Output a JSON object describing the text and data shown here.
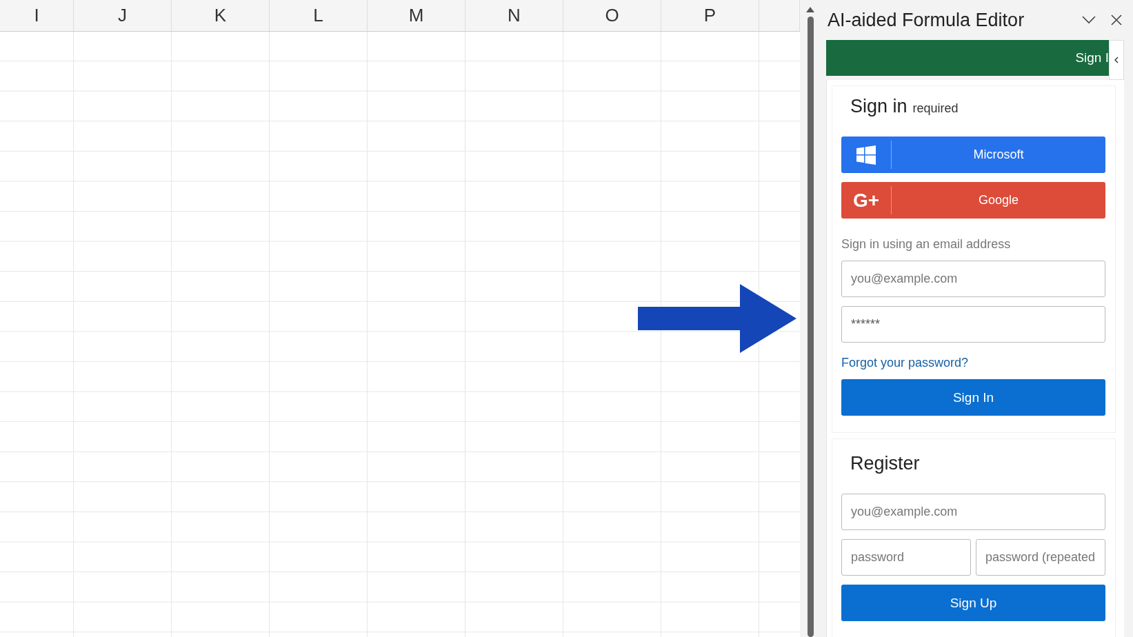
{
  "spreadsheet": {
    "columns": [
      "I",
      "J",
      "K",
      "L",
      "M",
      "N",
      "O",
      "P"
    ]
  },
  "pane": {
    "title": "AI-aided Formula Editor",
    "banner": {
      "text": "Sign I"
    },
    "signin": {
      "heading": "Sign in",
      "note": "required",
      "providers": [
        {
          "kind": "microsoft",
          "label": "Microsoft"
        },
        {
          "kind": "google",
          "label": "Google",
          "icon_text": "G+"
        }
      ],
      "email_hint": "Sign in using an email address",
      "email": {
        "placeholder": "you@example.com"
      },
      "password": {
        "value": "******"
      },
      "forgot_link": "Forgot your password?",
      "submit": "Sign In"
    },
    "register": {
      "heading": "Register",
      "email": {
        "placeholder": "you@example.com"
      },
      "password": {
        "placeholder": "password"
      },
      "password_repeat": {
        "placeholder": "password (repeated"
      },
      "submit": "Sign Up"
    }
  }
}
